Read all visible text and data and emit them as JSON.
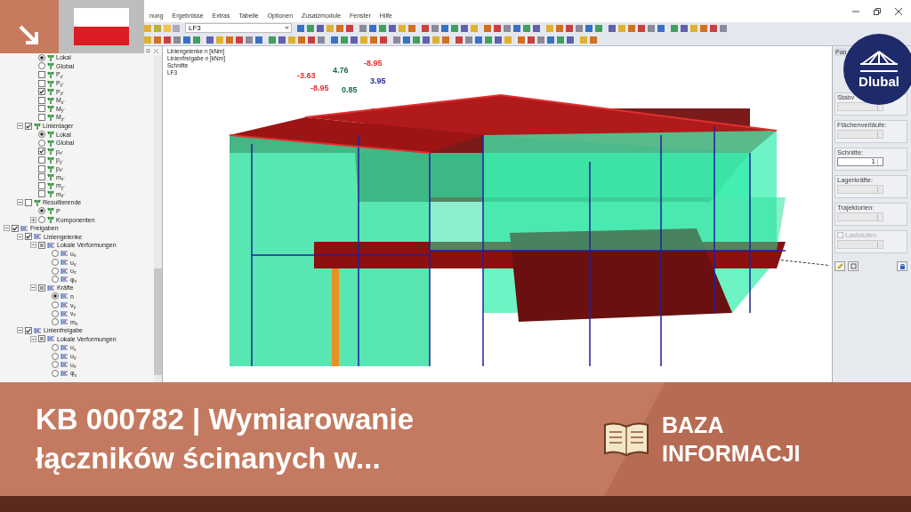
{
  "menu": [
    "nung",
    "Ergebnisse",
    "Extras",
    "Tabelle",
    "Optionen",
    "Zusatzmodule",
    "Fenster",
    "Hilfe"
  ],
  "toolbar": {
    "load_case": "LF3"
  },
  "tree": [
    {
      "children": [
        {
          "children": [
            {
              "label": "Lokal",
              "kind": "radio",
              "selected": true
            },
            {
              "label": "Global",
              "kind": "radio",
              "selected": false
            },
            {
              "label": "P$_{x'}$",
              "kind": "checkbox",
              "checked": false
            },
            {
              "label": "P$_{y'}$",
              "kind": "checkbox",
              "checked": false
            },
            {
              "label": "P$_{z'}$",
              "kind": "checkbox",
              "checked": true
            },
            {
              "label": "M$_{x'}$",
              "kind": "checkbox",
              "checked": false
            },
            {
              "label": "M$_{y'}$",
              "kind": "checkbox",
              "checked": false
            },
            {
              "label": "M$_{z'}$",
              "kind": "checkbox",
              "checked": false
            }
          ]
        },
        {
          "label": "Linienlager",
          "kind": "checkbox",
          "checked": true,
          "expanded": true,
          "children": [
            {
              "label": "Lokal",
              "kind": "radio",
              "selected": true
            },
            {
              "label": "Global",
              "kind": "radio",
              "selected": false
            },
            {
              "label": "p$_{x'}$",
              "kind": "checkbox",
              "checked": true
            },
            {
              "label": "p$_{y'}$",
              "kind": "checkbox",
              "checked": false
            },
            {
              "label": "p$_{z'}$",
              "kind": "checkbox",
              "checked": false
            },
            {
              "label": "m$_{x'}$",
              "kind": "checkbox",
              "checked": false
            },
            {
              "label": "m$_{y'}$",
              "kind": "checkbox",
              "checked": false
            },
            {
              "label": "m$_{z'}$",
              "kind": "checkbox",
              "checked": false
            }
          ]
        },
        {
          "label": "Resultierende",
          "kind": "checkbox",
          "checked": false,
          "expanded": true,
          "children": [
            {
              "label": "P",
              "kind": "radio",
              "selected": true
            },
            {
              "label": "Komponenten",
              "kind": "radio",
              "selected": false,
              "expanded": false
            }
          ]
        }
      ]
    },
    {
      "label": "Freigaben",
      "kind": "checkbox",
      "checked": true,
      "expanded": true,
      "children": [
        {
          "label": "Liniengelenke",
          "kind": "checkbox",
          "checked": true,
          "expanded": true,
          "children": [
            {
              "label": "Lokale Verformungen",
              "kind": "checkbox",
              "checked": false,
              "indeterminate": true,
              "expanded": true,
              "children": [
                {
                  "label": "u$_{x}$",
                  "kind": "radio",
                  "selected": false
                },
                {
                  "label": "u$_{y}$",
                  "kind": "radio",
                  "selected": false
                },
                {
                  "label": "u$_{z}$",
                  "kind": "radio",
                  "selected": false
                },
                {
                  "label": "φ$_{x}$",
                  "kind": "radio",
                  "selected": false
                }
              ]
            },
            {
              "label": "Kräfte",
              "kind": "checkbox",
              "checked": false,
              "indeterminate": true,
              "expanded": true,
              "children": [
                {
                  "label": "n",
                  "kind": "radio",
                  "selected": true
                },
                {
                  "label": "v$_{y}$",
                  "kind": "radio",
                  "selected": false
                },
                {
                  "label": "v$_{z}$",
                  "kind": "radio",
                  "selected": false
                },
                {
                  "label": "m$_{x}$",
                  "kind": "radio",
                  "selected": false
                }
              ]
            }
          ]
        },
        {
          "label": "Linienfreigabe",
          "kind": "checkbox",
          "checked": true,
          "expanded": true,
          "children": [
            {
              "label": "Lokale Verformungen",
              "kind": "checkbox",
              "checked": false,
              "indeterminate": true,
              "expanded": true,
              "children": [
                {
                  "label": "u$_{x}$",
                  "kind": "radio",
                  "selected": false
                },
                {
                  "label": "u$_{y}$",
                  "kind": "radio",
                  "selected": false
                },
                {
                  "label": "u$_{z}$",
                  "kind": "radio",
                  "selected": false
                },
                {
                  "label": "φ$_{x}$",
                  "kind": "radio",
                  "selected": false
                }
              ]
            }
          ]
        }
      ]
    }
  ],
  "viewport": {
    "legend": [
      "Liniengelenke n [kNm]",
      "Linienfreigabe n [kNm]",
      "Schnitte",
      "LF3"
    ],
    "values": [
      {
        "text": "-3.63",
        "color": "#e03030"
      },
      {
        "text": "4.76",
        "color": "#1a6a4a"
      },
      {
        "text": "-8.95",
        "color": "#e03030"
      },
      {
        "text": "-8.95",
        "color": "#e03030"
      },
      {
        "text": "0.85",
        "color": "#1a6a4a"
      },
      {
        "text": "3.95",
        "color": "#2a2aa0"
      }
    ]
  },
  "panel": {
    "tab": "Pan",
    "fields": [
      {
        "kind": "spinner",
        "label": "Stabv",
        "disabled": true
      },
      {
        "kind": "spinner",
        "label": "Flächenverläufe:",
        "disabled": true
      },
      {
        "kind": "spinner",
        "label": "Schnitte:",
        "disabled": false,
        "value": "1"
      },
      {
        "kind": "spinner",
        "label": "Lagerkräfte:",
        "disabled": true
      },
      {
        "kind": "spinner",
        "label": "Trajektorien:",
        "disabled": true
      },
      {
        "kind": "checkbox",
        "label": "Laststufen:",
        "disabled": true,
        "checked": false
      }
    ]
  },
  "logo": {
    "text": "Dlubal"
  },
  "banner": {
    "title": "KB 000782 | Wymiarowanie łączników ścinanych w...",
    "category": "BAZA INFORMACJI"
  }
}
